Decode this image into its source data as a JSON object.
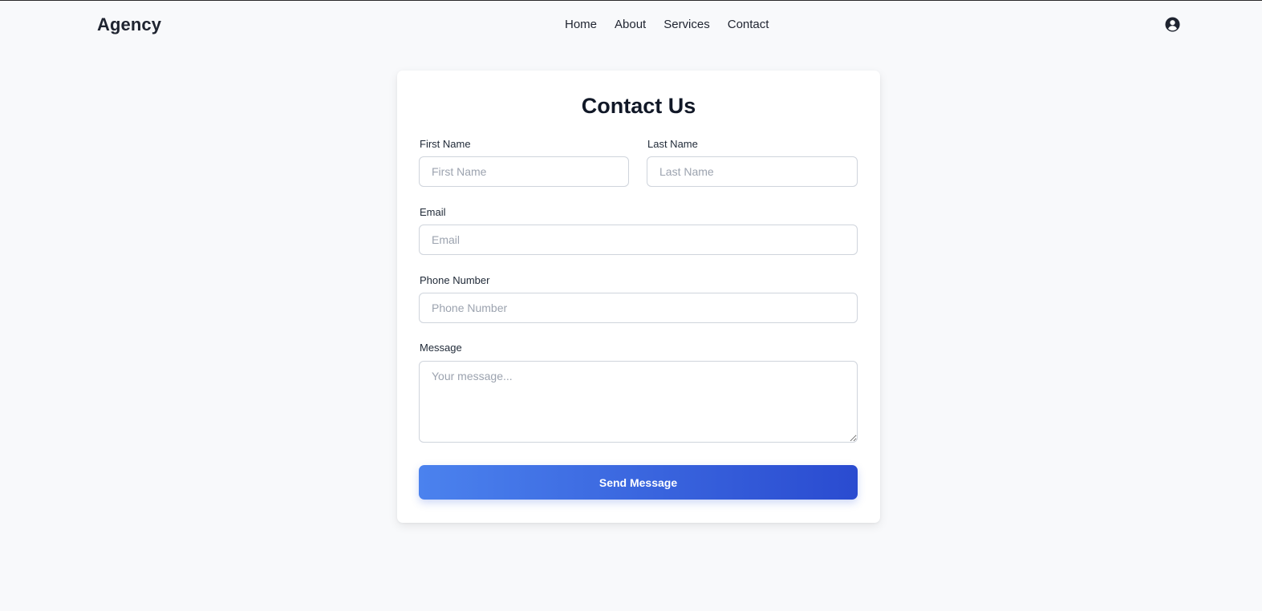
{
  "nav": {
    "brand": "Agency",
    "links": [
      "Home",
      "About",
      "Services",
      "Contact"
    ],
    "user_icon": "user-circle-icon"
  },
  "form": {
    "title": "Contact Us",
    "first_name": {
      "label": "First Name",
      "placeholder": "First Name",
      "value": ""
    },
    "last_name": {
      "label": "Last Name",
      "placeholder": "Last Name",
      "value": ""
    },
    "email": {
      "label": "Email",
      "placeholder": "Email",
      "value": ""
    },
    "phone": {
      "label": "Phone Number",
      "placeholder": "Phone Number",
      "value": ""
    },
    "message": {
      "label": "Message",
      "placeholder": "Your message...",
      "value": ""
    },
    "submit_label": "Send Message"
  },
  "colors": {
    "background": "#f8f9fb",
    "button_start": "#4b82ee",
    "button_end": "#2a4bd0"
  }
}
